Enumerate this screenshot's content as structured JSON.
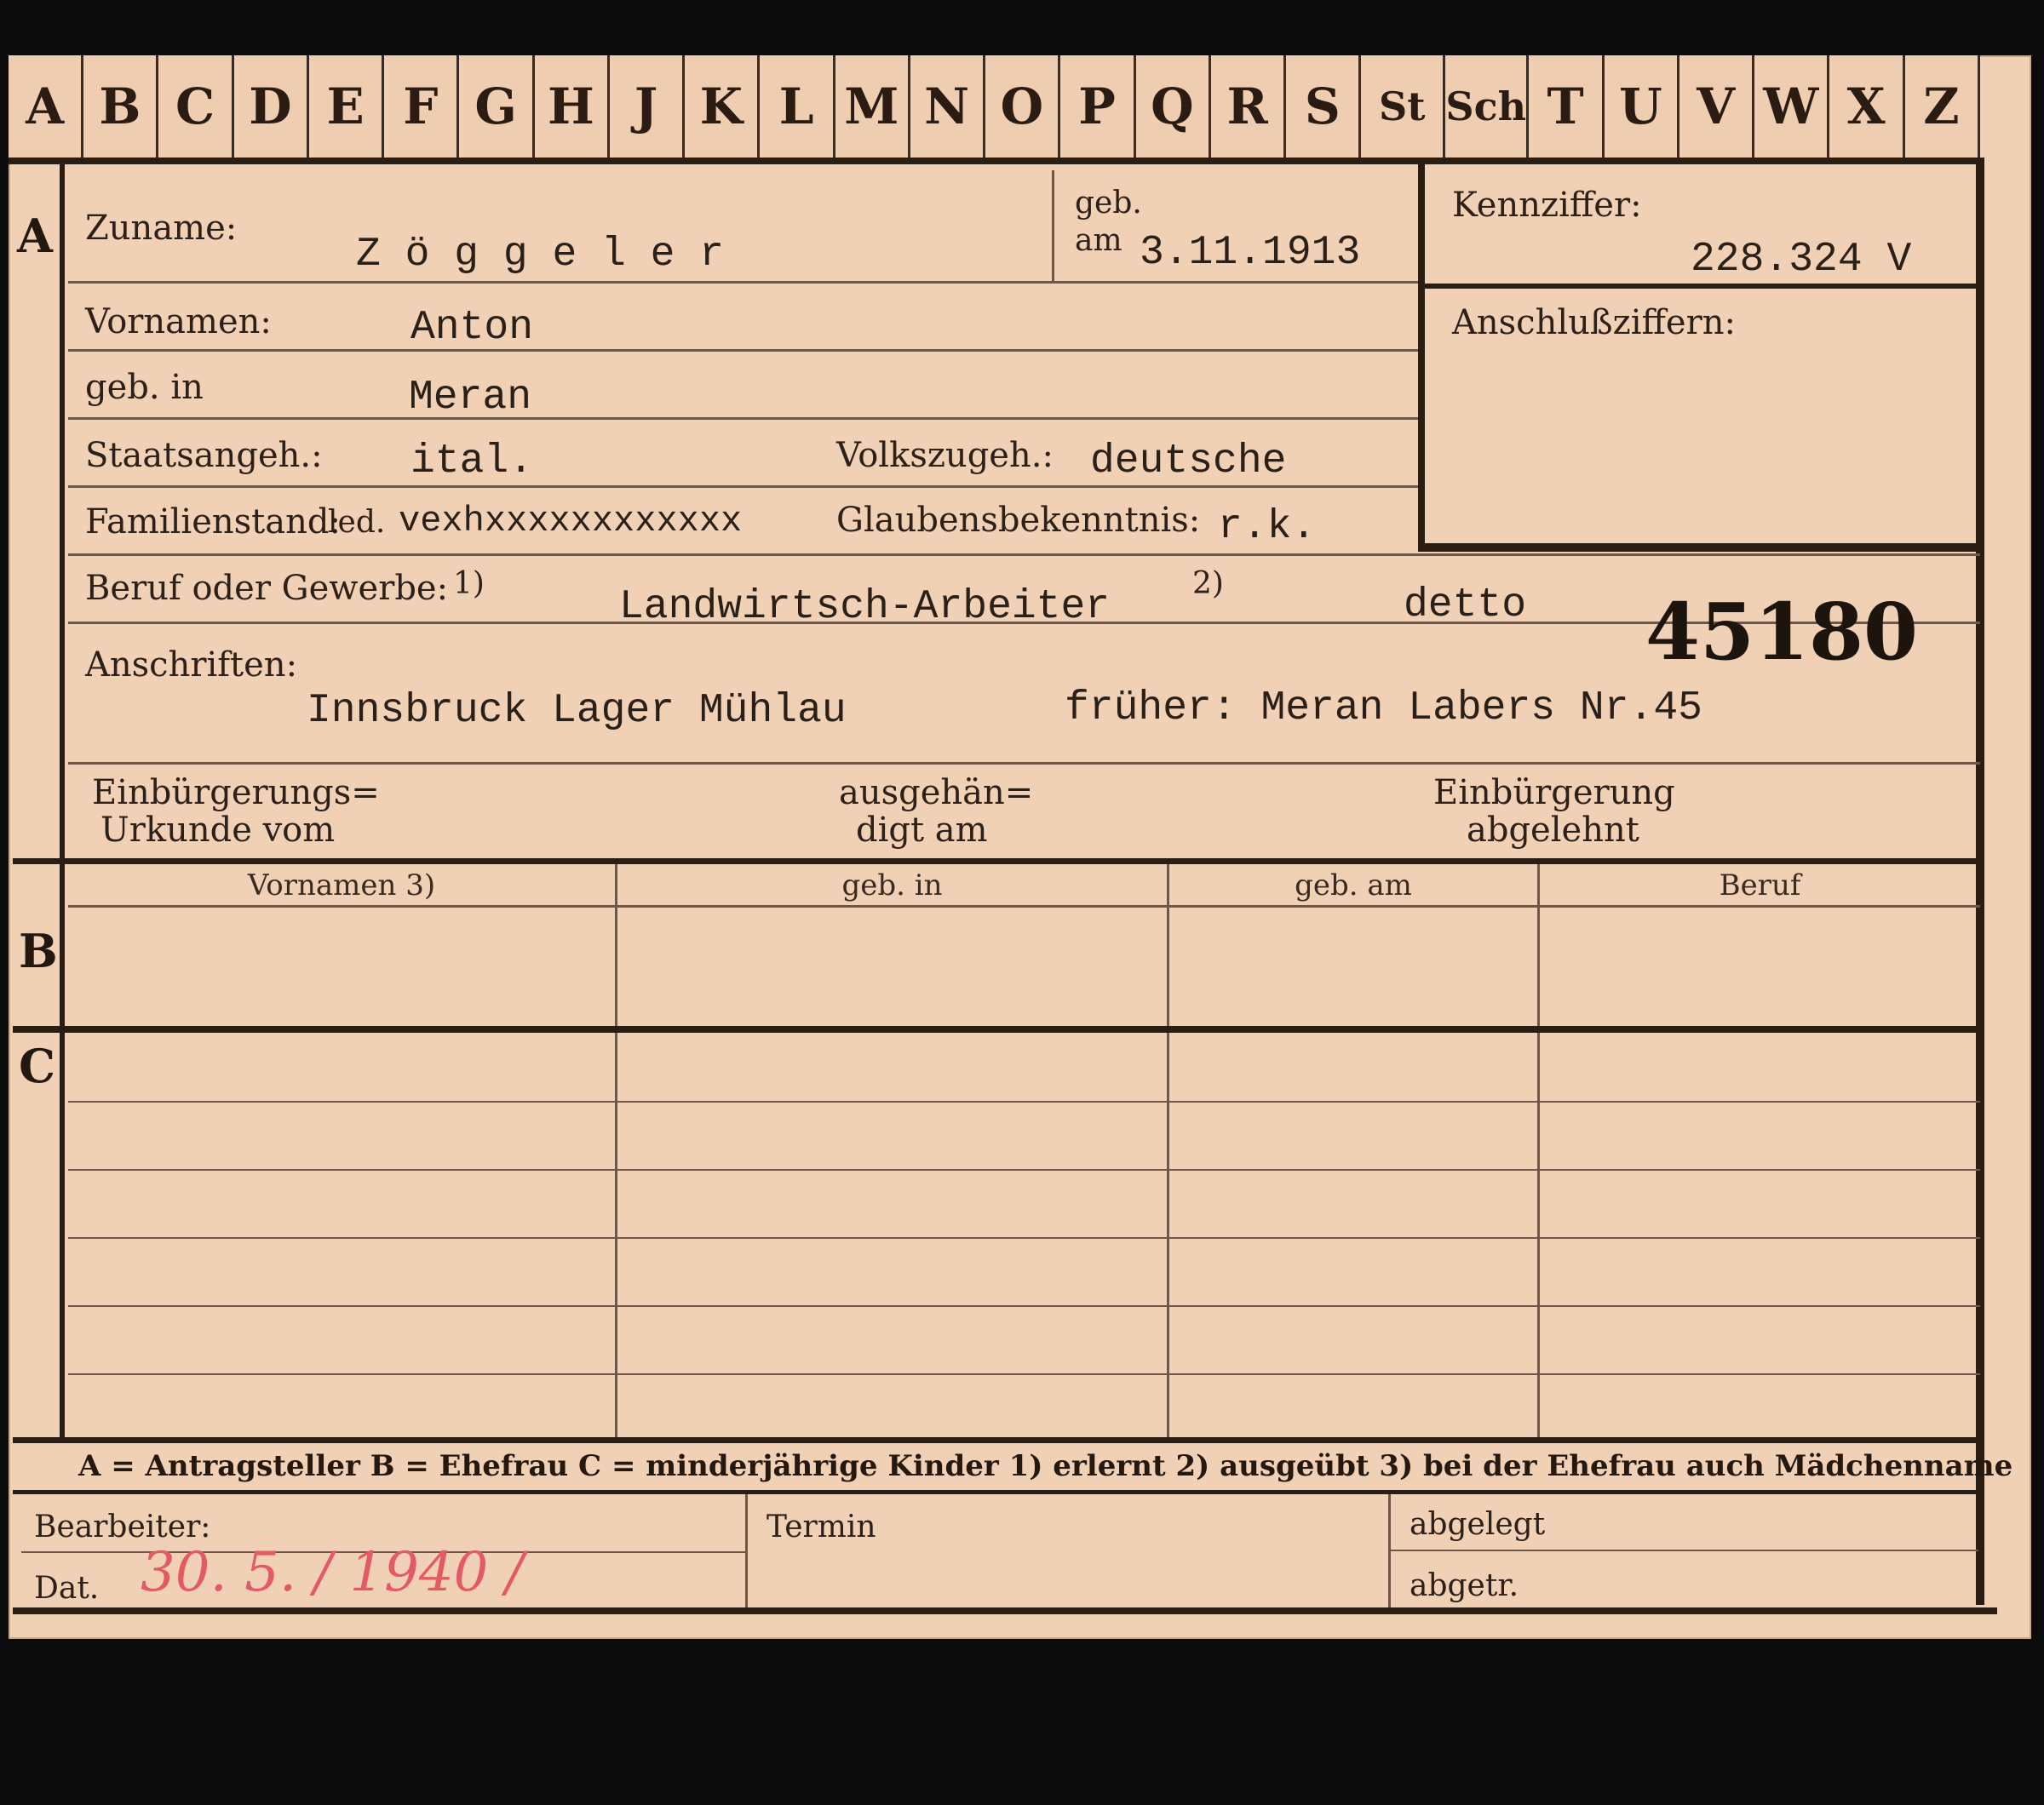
{
  "alphabet": [
    "A",
    "B",
    "C",
    "D",
    "E",
    "F",
    "G",
    "H",
    "J",
    "K",
    "L",
    "M",
    "N",
    "O",
    "P",
    "Q",
    "R",
    "S",
    "St",
    "Sch",
    "T",
    "U",
    "V",
    "W",
    "X",
    "Z"
  ],
  "sections": {
    "a": "A",
    "b": "B",
    "c": "C"
  },
  "fields": {
    "zuname_label": "Zuname:",
    "zuname_value": "Z ö g g e l e r",
    "geb_label": "geb.",
    "am_label": "am",
    "geb_am_value": "3.11.1913",
    "kennziffer_label": "Kennziffer:",
    "kennziffer_value": "228.324  V",
    "anschlussziffern_label": "Anschlußziffern:",
    "vornamen_label": "Vornamen:",
    "vornamen_value": "Anton",
    "geb_in_label": "geb. in",
    "geb_in_value": "Meran",
    "staatsangeh_label": "Staatsangeh.:",
    "staatsangeh_value": "ital.",
    "volkszugeh_label": "Volkszugeh.:",
    "volkszugeh_value": "deutsche",
    "familienstand_label": "Familienstand:",
    "familienstand_value": "led.",
    "familienstand_struck": "vexhxxxxxxxxxxxx",
    "glaubens_label": "Glaubensbekenntnis:",
    "glaubens_value": "r.k.",
    "beruf_label": "Beruf oder Gewerbe:",
    "beruf_note1": "1)",
    "beruf_value": "Landwirtsch-Arbeiter",
    "beruf_note2": "2)",
    "beruf_value2": "detto",
    "stamp_number": "45180",
    "anschriften_label": "Anschriften:",
    "anschrift_value": "Innsbruck Lager Mühlau",
    "frueher_value": "früher: Meran Labers Nr.45",
    "einb_urkunde_l1": "Einbürgerungs=",
    "einb_urkunde_l2": "Urkunde vom",
    "ausgehaen_l1": "ausgehän=",
    "ausgehaen_l2": "digt am",
    "einb_abgelehnt_l1": "Einbürgerung",
    "einb_abgelehnt_l2": "abgelehnt"
  },
  "table_headers": [
    "Vornamen 3)",
    "geb. in",
    "geb. am",
    "Beruf"
  ],
  "legend": "A = Antragsteller   B = Ehefrau   C = minderjährige Kinder   1) erlernt   2) ausgeübt   3) bei der Ehefrau auch Mädchenname",
  "footer": {
    "bearbeiter_label": "Bearbeiter:",
    "dat_label": "Dat.",
    "dat_value": "30. 5. / 1940 /",
    "termin_label": "Termin",
    "abgelegt_label": "abgelegt",
    "abgetr_label": "abgetr."
  }
}
